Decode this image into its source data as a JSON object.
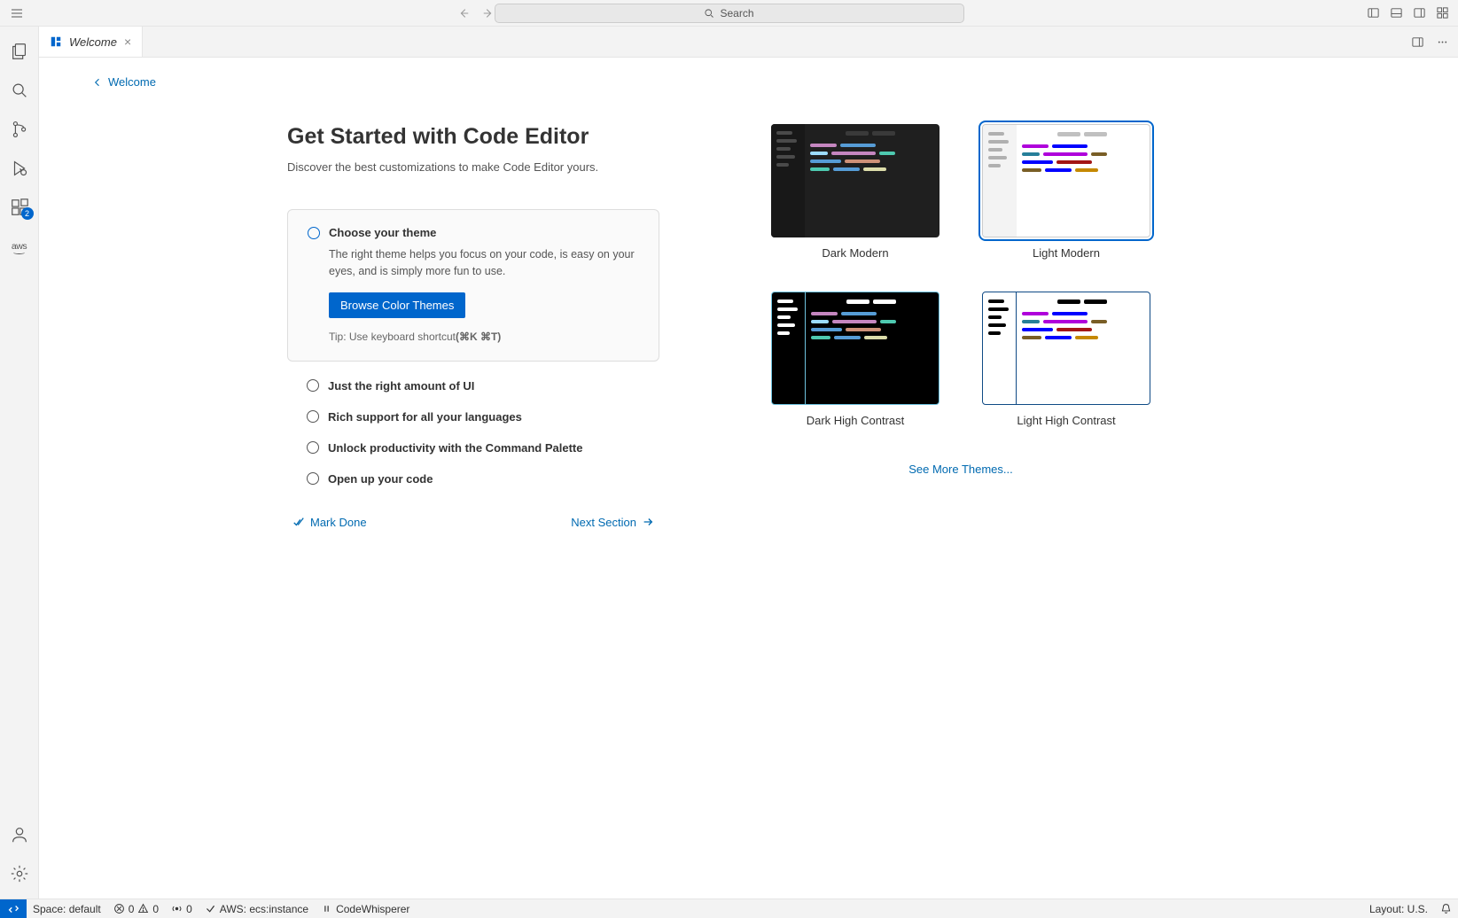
{
  "titlebar": {
    "search_placeholder": "Search"
  },
  "tab": {
    "label": "Welcome"
  },
  "breadcrumb": {
    "label": "Welcome"
  },
  "page": {
    "heading": "Get Started with Code Editor",
    "subtitle": "Discover the best customizations to make Code Editor yours."
  },
  "steps": {
    "active": {
      "title": "Choose your theme",
      "desc": "The right theme helps you focus on your code, is easy on your eyes, and is simply more fun to use.",
      "button": "Browse Color Themes",
      "tip_prefix": "Tip: Use keyboard shortcut",
      "tip_shortcut": "(⌘K ⌘T)"
    },
    "others": [
      "Just the right amount of UI",
      "Rich support for all your languages",
      "Unlock productivity with the Command Palette",
      "Open up your code"
    ]
  },
  "footer": {
    "mark_done": "Mark Done",
    "next_section": "Next Section"
  },
  "themes": {
    "dark_modern": "Dark Modern",
    "light_modern": "Light Modern",
    "dark_hc": "Dark High Contrast",
    "light_hc": "Light High Contrast",
    "more": "See More Themes..."
  },
  "activity": {
    "extensions_badge": "2",
    "aws_label": "aws"
  },
  "status": {
    "space": "Space: default",
    "errors": "0",
    "warnings": "0",
    "ports": "0",
    "aws": "AWS: ecs:instance",
    "codewhisperer": "CodeWhisperer",
    "layout": "Layout: U.S."
  }
}
